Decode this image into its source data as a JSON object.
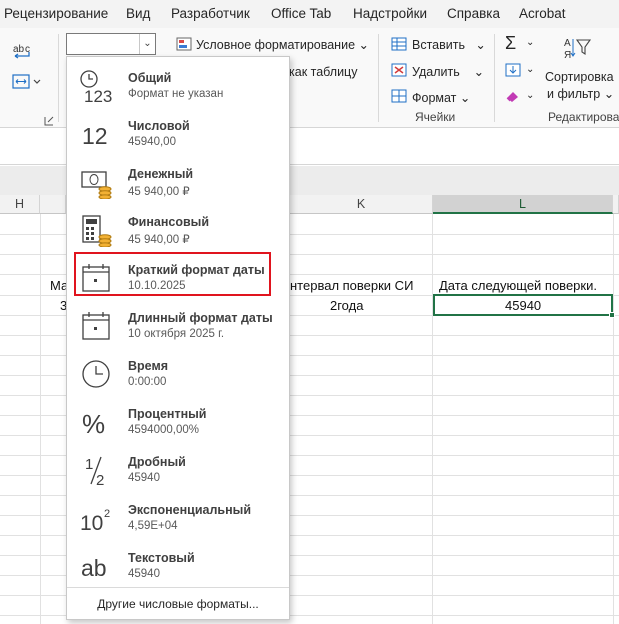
{
  "tabs": [
    "Рецензирование",
    "Вид",
    "Разработчик",
    "Office Tab",
    "Надстройки",
    "Справка",
    "Acrobat"
  ],
  "ribbon": {
    "number_format_value": "",
    "conditional_formatting": "Условное форматирование",
    "format_as_table": "как таблицу",
    "cells": {
      "insert": "Вставить",
      "delete": "Удалить",
      "format": "Формат",
      "group_label": "Ячейки"
    },
    "editing": {
      "sort_filter_line1": "Сортировка",
      "sort_filter_line2": "и фильтр",
      "group_label": "Редактирован"
    },
    "icons": [
      "abc-wrap-icon",
      "merge-icon",
      "sum-icon",
      "fill-down-icon",
      "eraser-icon",
      "sort-filter-icon"
    ]
  },
  "grid": {
    "columns": [
      {
        "label": "H",
        "selected": false
      },
      {
        "label": "K",
        "selected": false
      },
      {
        "label": "L",
        "selected": true
      }
    ],
    "cells": {
      "row1_a": "Ма",
      "row1_k": "нтервал поверки СИ",
      "row1_l": "Дата следующей поверки.",
      "row2_a": "3",
      "row2_k": "2года",
      "row2_l": "45940"
    },
    "accent_color": "#217346"
  },
  "dropdown": {
    "options": [
      {
        "name": "Общий",
        "sample": "Формат не указан",
        "icon": "clock-123-icon"
      },
      {
        "name": "Числовой",
        "sample": "45940,00",
        "icon": "number-12-icon"
      },
      {
        "name": "Денежный",
        "sample": "45 940,00 ₽",
        "icon": "money-icon"
      },
      {
        "name": "Финансовый",
        "sample": " 45 940,00 ₽",
        "icon": "calculator-icon"
      },
      {
        "name": "Краткий формат даты",
        "sample": "10.10.2025",
        "icon": "calendar-icon"
      },
      {
        "name": "Длинный формат даты",
        "sample": "10 октября 2025 г.",
        "icon": "calendar-icon"
      },
      {
        "name": "Время",
        "sample": "0:00:00",
        "icon": "clock-icon"
      },
      {
        "name": "Процентный",
        "sample": "4594000,00%",
        "icon": "percent-icon"
      },
      {
        "name": "Дробный",
        "sample": "45940",
        "icon": "fraction-icon"
      },
      {
        "name": "Экспоненциальный",
        "sample": "4,59E+04",
        "icon": "exponent-icon"
      },
      {
        "name": "Текстовый",
        "sample": "45940",
        "icon": "text-ab-icon"
      }
    ],
    "highlighted": "Краткий формат даты",
    "highlight_color": "#e0141e",
    "more_formats": "Другие числовые форматы..."
  }
}
